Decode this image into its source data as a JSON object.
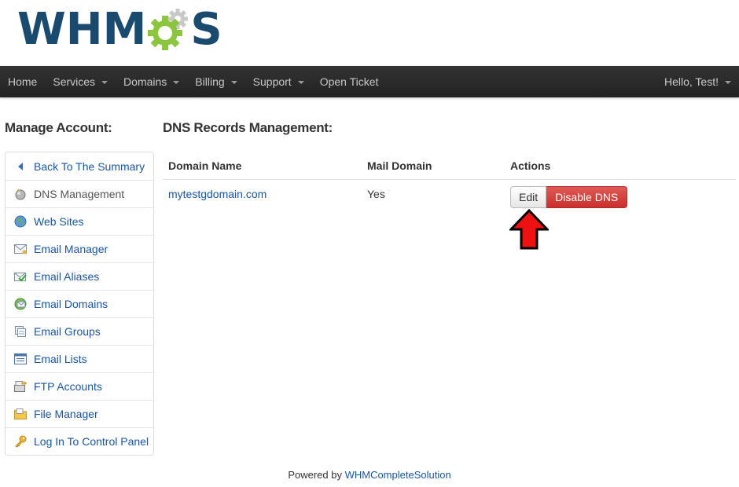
{
  "logo": {
    "left": "WHM",
    "right": "S",
    "colors": {
      "text": "#1a4a6e",
      "gear_outer": "#8cc63f",
      "gear_inner": "#6aa22d",
      "gear_grey": "#c8c8c8"
    }
  },
  "navbar": {
    "items": [
      {
        "label": "Home",
        "dropdown": false
      },
      {
        "label": "Services",
        "dropdown": true
      },
      {
        "label": "Domains",
        "dropdown": true
      },
      {
        "label": "Billing",
        "dropdown": true
      },
      {
        "label": "Support",
        "dropdown": true
      },
      {
        "label": "Open Ticket",
        "dropdown": false
      }
    ],
    "user": "Hello, Test!"
  },
  "sidebar": {
    "title": "Manage Account:",
    "items": [
      {
        "label": "Back To The Summary",
        "icon": "back-arrow-icon"
      },
      {
        "label": "DNS Management",
        "icon": "dns-icon",
        "active": true
      },
      {
        "label": "Web Sites",
        "icon": "globe-icon"
      },
      {
        "label": "Email Manager",
        "icon": "envelope-icon"
      },
      {
        "label": "Email Aliases",
        "icon": "email-alias-icon"
      },
      {
        "label": "Email Domains",
        "icon": "email-domain-icon"
      },
      {
        "label": "Email Groups",
        "icon": "email-groups-icon"
      },
      {
        "label": "Email Lists",
        "icon": "list-icon"
      },
      {
        "label": "FTP Accounts",
        "icon": "ftp-icon"
      },
      {
        "label": "File Manager",
        "icon": "folder-icon"
      },
      {
        "label": "Log In To Control Panel",
        "icon": "key-icon"
      }
    ]
  },
  "main": {
    "title": "DNS Records Management:",
    "columns": [
      "Domain Name",
      "Mail Domain",
      "Actions"
    ],
    "rows": [
      {
        "domain": "mytestgdomain.com",
        "mail_domain": "Yes",
        "edit_label": "Edit",
        "disable_label": "Disable DNS"
      }
    ]
  },
  "footer": {
    "prefix": "Powered by ",
    "link": "WHMCompleteSolution"
  }
}
